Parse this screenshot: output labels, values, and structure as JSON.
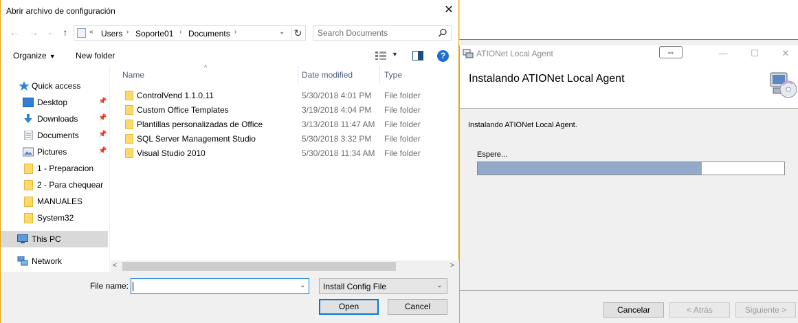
{
  "installer": {
    "title": "ATIONet Local Agent",
    "heading": "Instalando ATIONet Local Agent",
    "message": "Instalando ATIONet Local Agent.",
    "wait_label": "Espere...",
    "progress": 0.73,
    "buttons": {
      "cancel": "Cancelar",
      "back": "< Atrás",
      "next": "Siguiente >"
    }
  },
  "dialog": {
    "title": "Abrir archivo de configuración",
    "breadcrumb": [
      "Users",
      "Soporte01",
      "Documents"
    ],
    "breadcrumb_prefix": "«",
    "search_placeholder": "Search Documents",
    "toolbar": {
      "organize": "Organize",
      "new_folder": "New folder"
    },
    "nav": {
      "quick_access": "Quick access",
      "pinned": [
        "Desktop",
        "Downloads",
        "Documents",
        "Pictures"
      ],
      "folders": [
        "1 - Preparacion",
        "2 - Para chequear",
        "MANUALES",
        "System32"
      ],
      "this_pc": "This PC",
      "network": "Network"
    },
    "columns": {
      "name": "Name",
      "date": "Date modified",
      "type": "Type"
    },
    "files": [
      {
        "name": "ControlVend 1.1.0.11",
        "date": "5/30/2018 4:01 PM",
        "type": "File folder"
      },
      {
        "name": "Custom Office Templates",
        "date": "3/19/2018 4:04 PM",
        "type": "File folder"
      },
      {
        "name": "Plantillas personalizadas de Office",
        "date": "3/13/2018 11:47 AM",
        "type": "File folder"
      },
      {
        "name": "SQL Server Management Studio",
        "date": "5/30/2018 3:32 PM",
        "type": "File folder"
      },
      {
        "name": "Visual Studio 2010",
        "date": "5/30/2018 11:34 AM",
        "type": "File folder"
      }
    ],
    "file_name_label": "File name:",
    "file_name_value": "",
    "file_type": "Install Config File",
    "open_label": "Open",
    "cancel_label": "Cancel"
  }
}
